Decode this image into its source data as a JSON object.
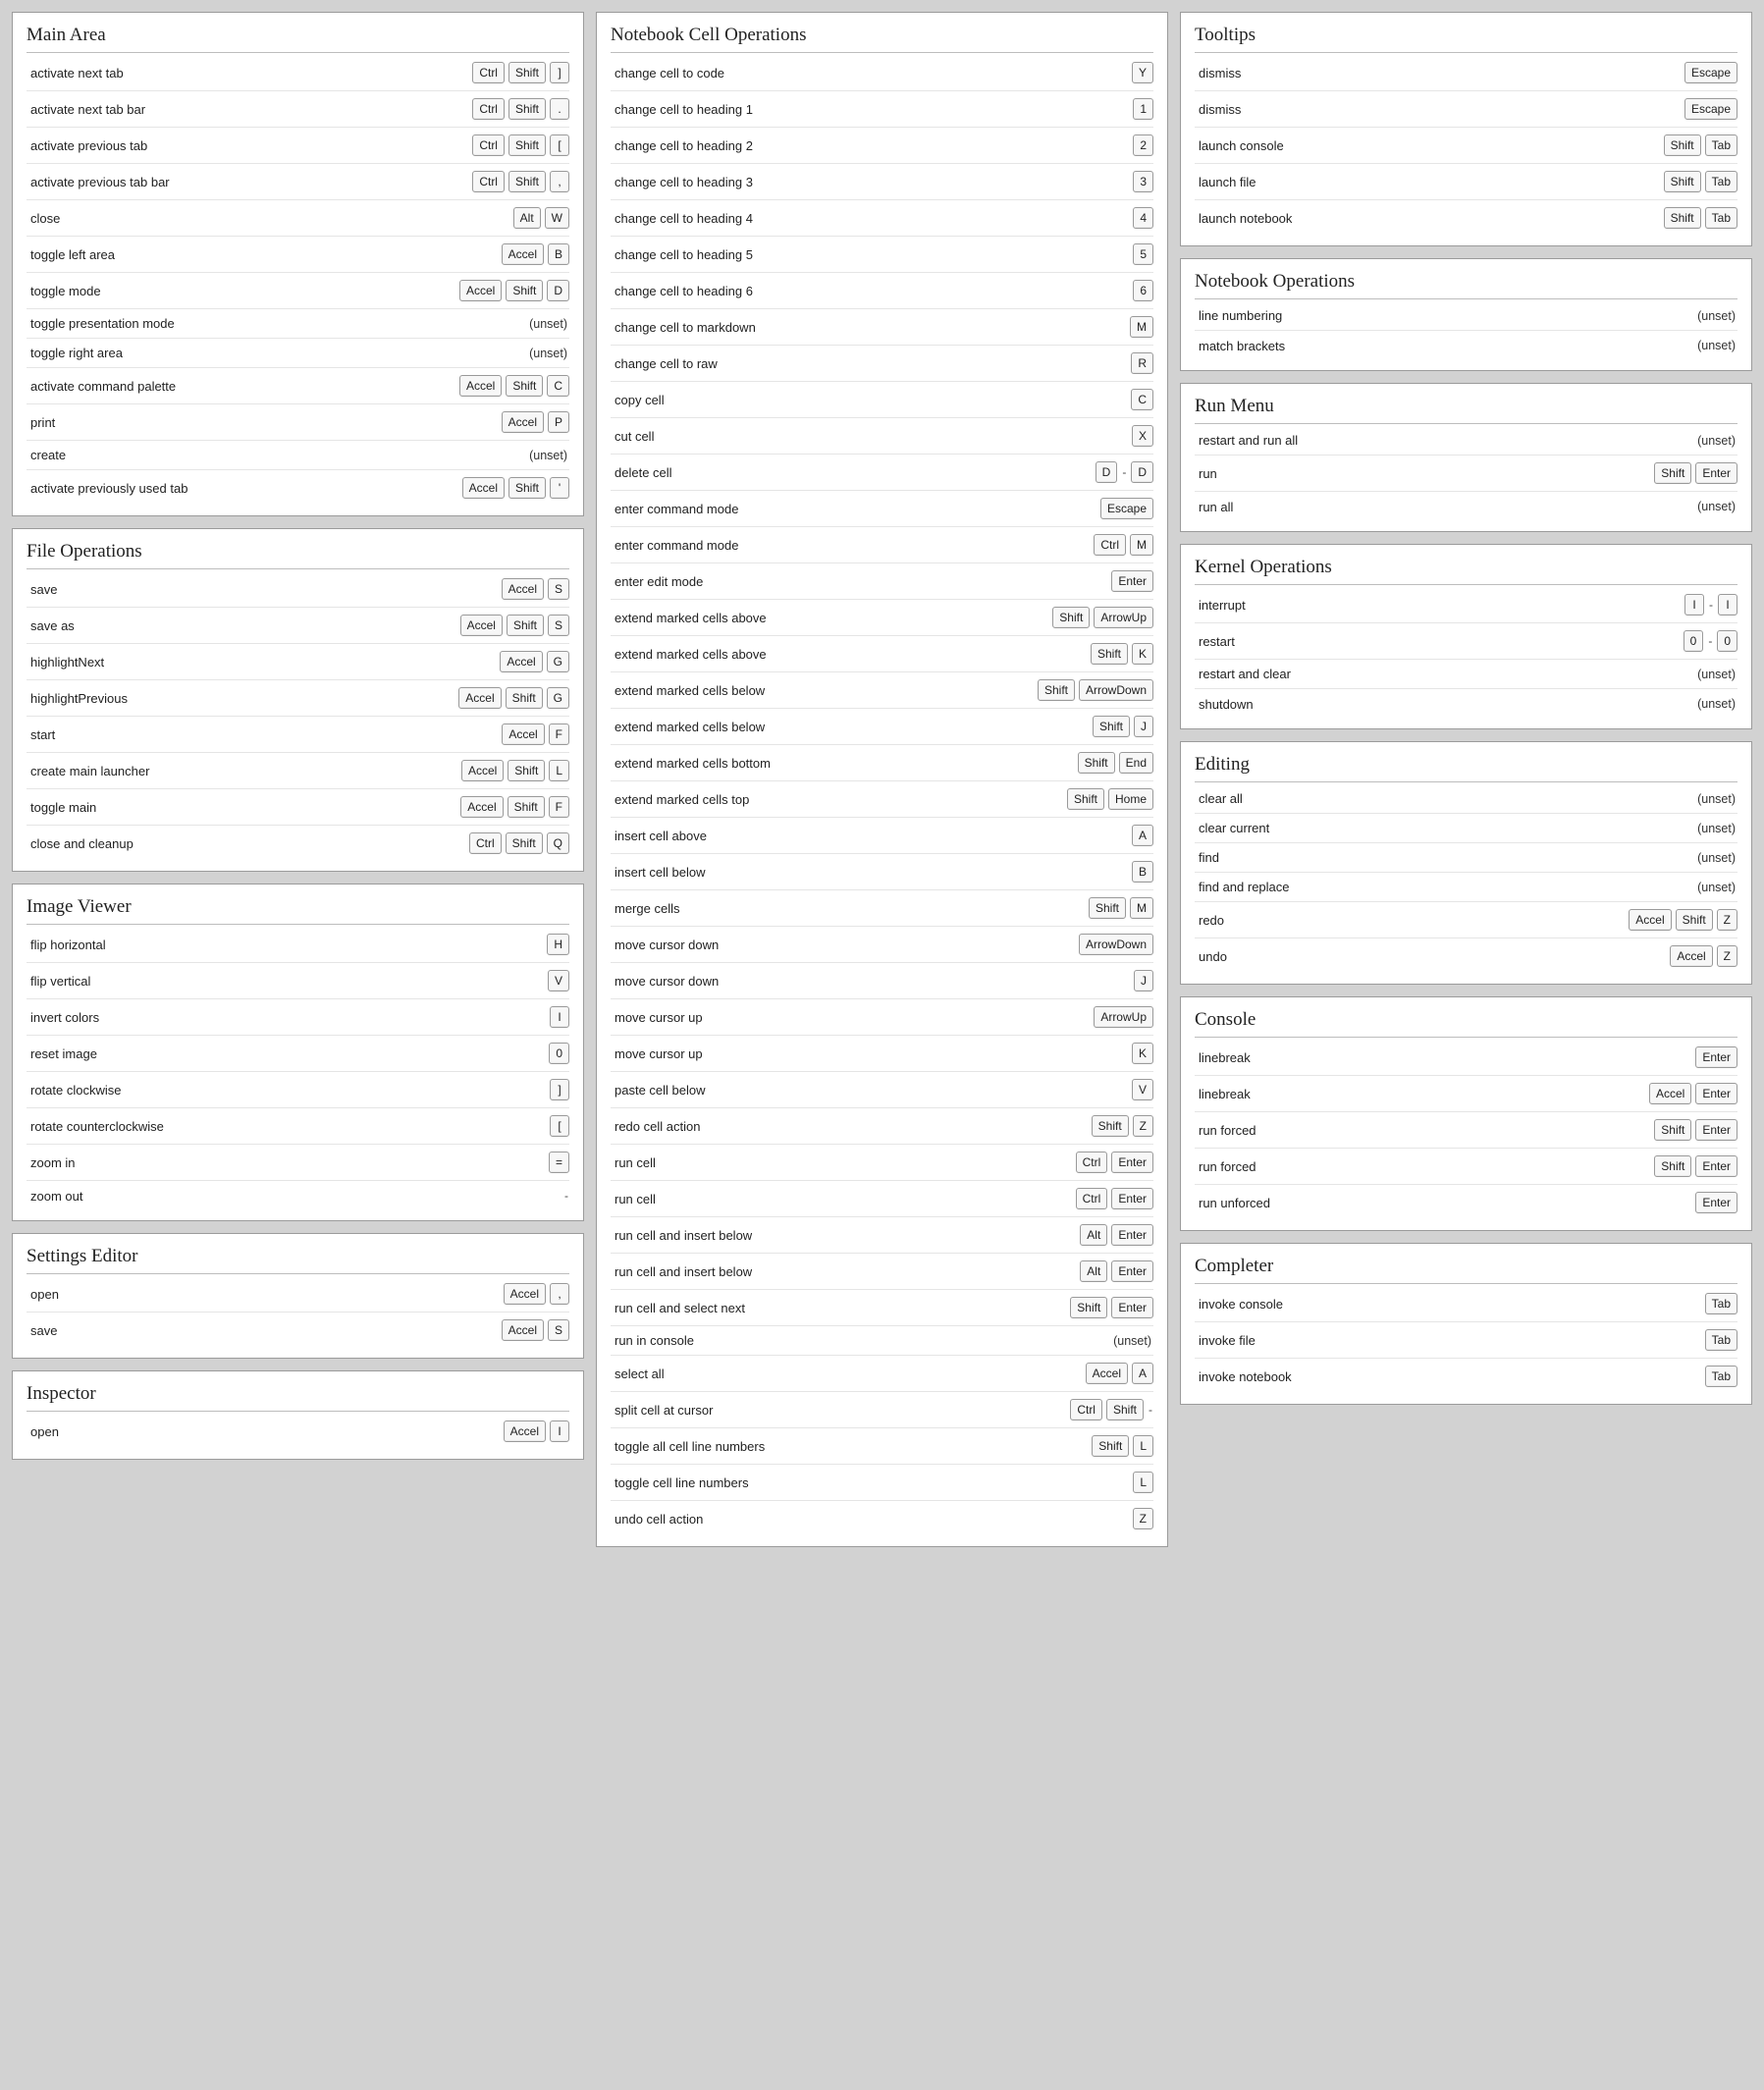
{
  "unset_text": "(unset)",
  "columns": [
    [
      {
        "title": "Main Area",
        "rows": [
          {
            "label": "activate next tab",
            "keys": [
              "Ctrl",
              "Shift",
              "]"
            ]
          },
          {
            "label": "activate next tab bar",
            "keys": [
              "Ctrl",
              "Shift",
              "."
            ]
          },
          {
            "label": "activate previous tab",
            "keys": [
              "Ctrl",
              "Shift",
              "["
            ]
          },
          {
            "label": "activate previous tab bar",
            "keys": [
              "Ctrl",
              "Shift",
              ","
            ]
          },
          {
            "label": "close",
            "keys": [
              "Alt",
              "W"
            ]
          },
          {
            "label": "toggle left area",
            "keys": [
              "Accel",
              "B"
            ]
          },
          {
            "label": "toggle mode",
            "keys": [
              "Accel",
              "Shift",
              "D"
            ]
          },
          {
            "label": "toggle presentation mode",
            "unset": true
          },
          {
            "label": "toggle right area",
            "unset": true
          },
          {
            "label": "activate command palette",
            "keys": [
              "Accel",
              "Shift",
              "C"
            ]
          },
          {
            "label": "print",
            "keys": [
              "Accel",
              "P"
            ]
          },
          {
            "label": "create",
            "unset": true
          },
          {
            "label": "activate previously used tab",
            "keys": [
              "Accel",
              "Shift",
              "'"
            ]
          }
        ]
      },
      {
        "title": "File Operations",
        "rows": [
          {
            "label": "save",
            "keys": [
              "Accel",
              "S"
            ]
          },
          {
            "label": "save as",
            "keys": [
              "Accel",
              "Shift",
              "S"
            ]
          },
          {
            "label": "highlightNext",
            "keys": [
              "Accel",
              "G"
            ]
          },
          {
            "label": "highlightPrevious",
            "keys": [
              "Accel",
              "Shift",
              "G"
            ]
          },
          {
            "label": "start",
            "keys": [
              "Accel",
              "F"
            ]
          },
          {
            "label": "create main launcher",
            "keys": [
              "Accel",
              "Shift",
              "L"
            ]
          },
          {
            "label": "toggle main",
            "keys": [
              "Accel",
              "Shift",
              "F"
            ]
          },
          {
            "label": "close and cleanup",
            "keys": [
              "Ctrl",
              "Shift",
              "Q"
            ]
          }
        ]
      },
      {
        "title": "Image Viewer",
        "rows": [
          {
            "label": "flip horizontal",
            "keys": [
              "H"
            ]
          },
          {
            "label": "flip vertical",
            "keys": [
              "V"
            ]
          },
          {
            "label": "invert colors",
            "keys": [
              "I"
            ]
          },
          {
            "label": "reset image",
            "keys": [
              "0"
            ]
          },
          {
            "label": "rotate clockwise",
            "keys": [
              "]"
            ]
          },
          {
            "label": "rotate counterclockwise",
            "keys": [
              "["
            ]
          },
          {
            "label": "zoom in",
            "keys": [
              "="
            ]
          },
          {
            "label": "zoom out",
            "keys": [
              "-"
            ]
          }
        ]
      },
      {
        "title": "Settings Editor",
        "rows": [
          {
            "label": "open",
            "keys": [
              "Accel",
              ","
            ]
          },
          {
            "label": "save",
            "keys": [
              "Accel",
              "S"
            ]
          }
        ]
      },
      {
        "title": "Inspector",
        "rows": [
          {
            "label": "open",
            "keys": [
              "Accel",
              "I"
            ]
          }
        ]
      }
    ],
    [
      {
        "title": "Notebook Cell Operations",
        "rows": [
          {
            "label": "change cell to code",
            "keys": [
              "Y"
            ]
          },
          {
            "label": "change cell to heading 1",
            "keys": [
              "1"
            ]
          },
          {
            "label": "change cell to heading 2",
            "keys": [
              "2"
            ]
          },
          {
            "label": "change cell to heading 3",
            "keys": [
              "3"
            ]
          },
          {
            "label": "change cell to heading 4",
            "keys": [
              "4"
            ]
          },
          {
            "label": "change cell to heading 5",
            "keys": [
              "5"
            ]
          },
          {
            "label": "change cell to heading 6",
            "keys": [
              "6"
            ]
          },
          {
            "label": "change cell to markdown",
            "keys": [
              "M"
            ]
          },
          {
            "label": "change cell to raw",
            "keys": [
              "R"
            ]
          },
          {
            "label": "copy cell",
            "keys": [
              "C"
            ]
          },
          {
            "label": "cut cell",
            "keys": [
              "X"
            ]
          },
          {
            "label": "delete cell",
            "keys": [
              "D",
              "-",
              "D"
            ]
          },
          {
            "label": "enter command mode",
            "keys": [
              "Escape"
            ]
          },
          {
            "label": "enter command mode",
            "keys": [
              "Ctrl",
              "M"
            ]
          },
          {
            "label": "enter edit mode",
            "keys": [
              "Enter"
            ]
          },
          {
            "label": "extend marked cells above",
            "keys": [
              "Shift",
              "ArrowUp"
            ]
          },
          {
            "label": "extend marked cells above",
            "keys": [
              "Shift",
              "K"
            ]
          },
          {
            "label": "extend marked cells below",
            "keys": [
              "Shift",
              "ArrowDown"
            ]
          },
          {
            "label": "extend marked cells below",
            "keys": [
              "Shift",
              "J"
            ]
          },
          {
            "label": "extend marked cells bottom",
            "keys": [
              "Shift",
              "End"
            ]
          },
          {
            "label": "extend marked cells top",
            "keys": [
              "Shift",
              "Home"
            ]
          },
          {
            "label": "insert cell above",
            "keys": [
              "A"
            ]
          },
          {
            "label": "insert cell below",
            "keys": [
              "B"
            ]
          },
          {
            "label": "merge cells",
            "keys": [
              "Shift",
              "M"
            ]
          },
          {
            "label": "move cursor down",
            "keys": [
              "ArrowDown"
            ]
          },
          {
            "label": "move cursor down",
            "keys": [
              "J"
            ]
          },
          {
            "label": "move cursor up",
            "keys": [
              "ArrowUp"
            ]
          },
          {
            "label": "move cursor up",
            "keys": [
              "K"
            ]
          },
          {
            "label": "paste cell below",
            "keys": [
              "V"
            ]
          },
          {
            "label": "redo cell action",
            "keys": [
              "Shift",
              "Z"
            ]
          },
          {
            "label": "run cell",
            "keys": [
              "Ctrl",
              "Enter"
            ]
          },
          {
            "label": "run cell",
            "keys": [
              "Ctrl",
              "Enter"
            ]
          },
          {
            "label": "run cell and insert below",
            "keys": [
              "Alt",
              "Enter"
            ]
          },
          {
            "label": "run cell and insert below",
            "keys": [
              "Alt",
              "Enter"
            ]
          },
          {
            "label": "run cell and select next",
            "keys": [
              "Shift",
              "Enter"
            ]
          },
          {
            "label": "run in console",
            "unset": true
          },
          {
            "label": "select all",
            "keys": [
              "Accel",
              "A"
            ]
          },
          {
            "label": "split cell at cursor",
            "keys": [
              "Ctrl",
              "Shift",
              "-"
            ]
          },
          {
            "label": "toggle all cell line numbers",
            "keys": [
              "Shift",
              "L"
            ]
          },
          {
            "label": "toggle cell line numbers",
            "keys": [
              "L"
            ]
          },
          {
            "label": "undo cell action",
            "keys": [
              "Z"
            ]
          }
        ]
      }
    ],
    [
      {
        "title": "Tooltips",
        "rows": [
          {
            "label": "dismiss",
            "keys": [
              "Escape"
            ]
          },
          {
            "label": "dismiss",
            "keys": [
              "Escape"
            ]
          },
          {
            "label": "launch console",
            "keys": [
              "Shift",
              "Tab"
            ]
          },
          {
            "label": "launch file",
            "keys": [
              "Shift",
              "Tab"
            ]
          },
          {
            "label": "launch notebook",
            "keys": [
              "Shift",
              "Tab"
            ]
          }
        ]
      },
      {
        "title": "Notebook Operations",
        "rows": [
          {
            "label": "line numbering",
            "unset": true
          },
          {
            "label": "match brackets",
            "unset": true
          }
        ]
      },
      {
        "title": "Run Menu",
        "rows": [
          {
            "label": "restart and run all",
            "unset": true
          },
          {
            "label": "run",
            "keys": [
              "Shift",
              "Enter"
            ]
          },
          {
            "label": "run all",
            "unset": true
          }
        ]
      },
      {
        "title": "Kernel Operations",
        "rows": [
          {
            "label": "interrupt",
            "keys": [
              "I",
              "-",
              "I"
            ]
          },
          {
            "label": "restart",
            "keys": [
              "0",
              "-",
              "0"
            ]
          },
          {
            "label": "restart and clear",
            "unset": true
          },
          {
            "label": "shutdown",
            "unset": true
          }
        ]
      },
      {
        "title": "Editing",
        "rows": [
          {
            "label": "clear all",
            "unset": true
          },
          {
            "label": "clear current",
            "unset": true
          },
          {
            "label": "find",
            "unset": true
          },
          {
            "label": "find and replace",
            "unset": true
          },
          {
            "label": "redo",
            "keys": [
              "Accel",
              "Shift",
              "Z"
            ]
          },
          {
            "label": "undo",
            "keys": [
              "Accel",
              "Z"
            ]
          }
        ]
      },
      {
        "title": "Console",
        "rows": [
          {
            "label": "linebreak",
            "keys": [
              "Enter"
            ]
          },
          {
            "label": "linebreak",
            "keys": [
              "Accel",
              "Enter"
            ]
          },
          {
            "label": "run forced",
            "keys": [
              "Shift",
              "Enter"
            ]
          },
          {
            "label": "run forced",
            "keys": [
              "Shift",
              "Enter"
            ]
          },
          {
            "label": "run unforced",
            "keys": [
              "Enter"
            ]
          }
        ]
      },
      {
        "title": "Completer",
        "rows": [
          {
            "label": "invoke console",
            "keys": [
              "Tab"
            ]
          },
          {
            "label": "invoke file",
            "keys": [
              "Tab"
            ]
          },
          {
            "label": "invoke notebook",
            "keys": [
              "Tab"
            ]
          }
        ]
      }
    ]
  ]
}
